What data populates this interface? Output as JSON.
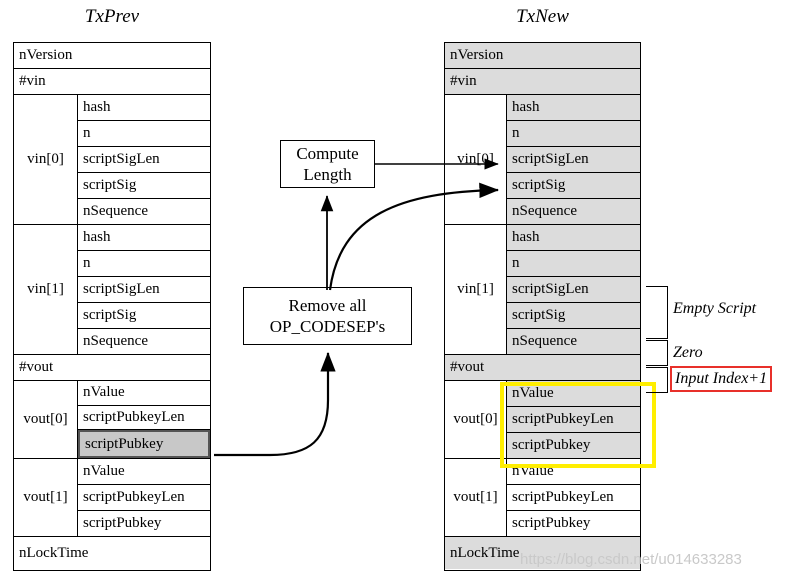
{
  "diagram": {
    "title_left": "TxPrev",
    "title_right": "TxNew",
    "watermark": "https://blog.csdn.net/u014633283",
    "colors": {
      "gray_fill": "#dcdcdc",
      "highlight_cell": "#c8c8c8",
      "yellow_box": "#ffee00",
      "red_box": "#e8302a",
      "stroke": "#000000"
    }
  },
  "txprev": {
    "title": "TxPrev",
    "rows": {
      "nversion": "nVersion",
      "nvin": "#vin",
      "nvout": "#vout",
      "nlocktime": "nLockTime"
    },
    "vin": [
      {
        "label": "vin[0]",
        "fields": [
          "hash",
          "n",
          "scriptSigLen",
          "scriptSig",
          "nSequence"
        ]
      },
      {
        "label": "vin[1]",
        "fields": [
          "hash",
          "n",
          "scriptSigLen",
          "scriptSig",
          "nSequence"
        ]
      }
    ],
    "vout": [
      {
        "label": "vout[0]",
        "fields": [
          "nValue",
          "scriptPubkeyLen",
          "scriptPubkey"
        ]
      },
      {
        "label": "vout[1]",
        "fields": [
          "nValue",
          "scriptPubkeyLen",
          "scriptPubkey"
        ]
      }
    ],
    "highlighted_field": "scriptPubkey"
  },
  "txnew": {
    "title": "TxNew",
    "rows": {
      "nversion": "nVersion",
      "nvin": "#vin",
      "nvout": "#vout",
      "nlocktime": "nLockTime"
    },
    "vin": [
      {
        "label": "vin[0]",
        "fields": [
          "hash",
          "n",
          "scriptSigLen",
          "scriptSig",
          "nSequence"
        ]
      },
      {
        "label": "vin[1]",
        "fields": [
          "hash",
          "n",
          "scriptSigLen",
          "scriptSig",
          "nSequence"
        ]
      }
    ],
    "vout": [
      {
        "label": "vout[0]",
        "fields": [
          "nValue",
          "scriptPubkeyLen",
          "scriptPubkey"
        ]
      },
      {
        "label": "vout[1]",
        "fields": [
          "nValue",
          "scriptPubkeyLen",
          "scriptPubkey"
        ]
      }
    ]
  },
  "process_boxes": {
    "compute_length": "Compute\nLength",
    "compute_length_line1": "Compute",
    "compute_length_line2": "Length",
    "remove_codesep_line1": "Remove all",
    "remove_codesep_line2": "OP_CODESEP's"
  },
  "annotations": {
    "empty_script": "Empty Script",
    "zero": "Zero",
    "input_index": "Input Index+1"
  }
}
